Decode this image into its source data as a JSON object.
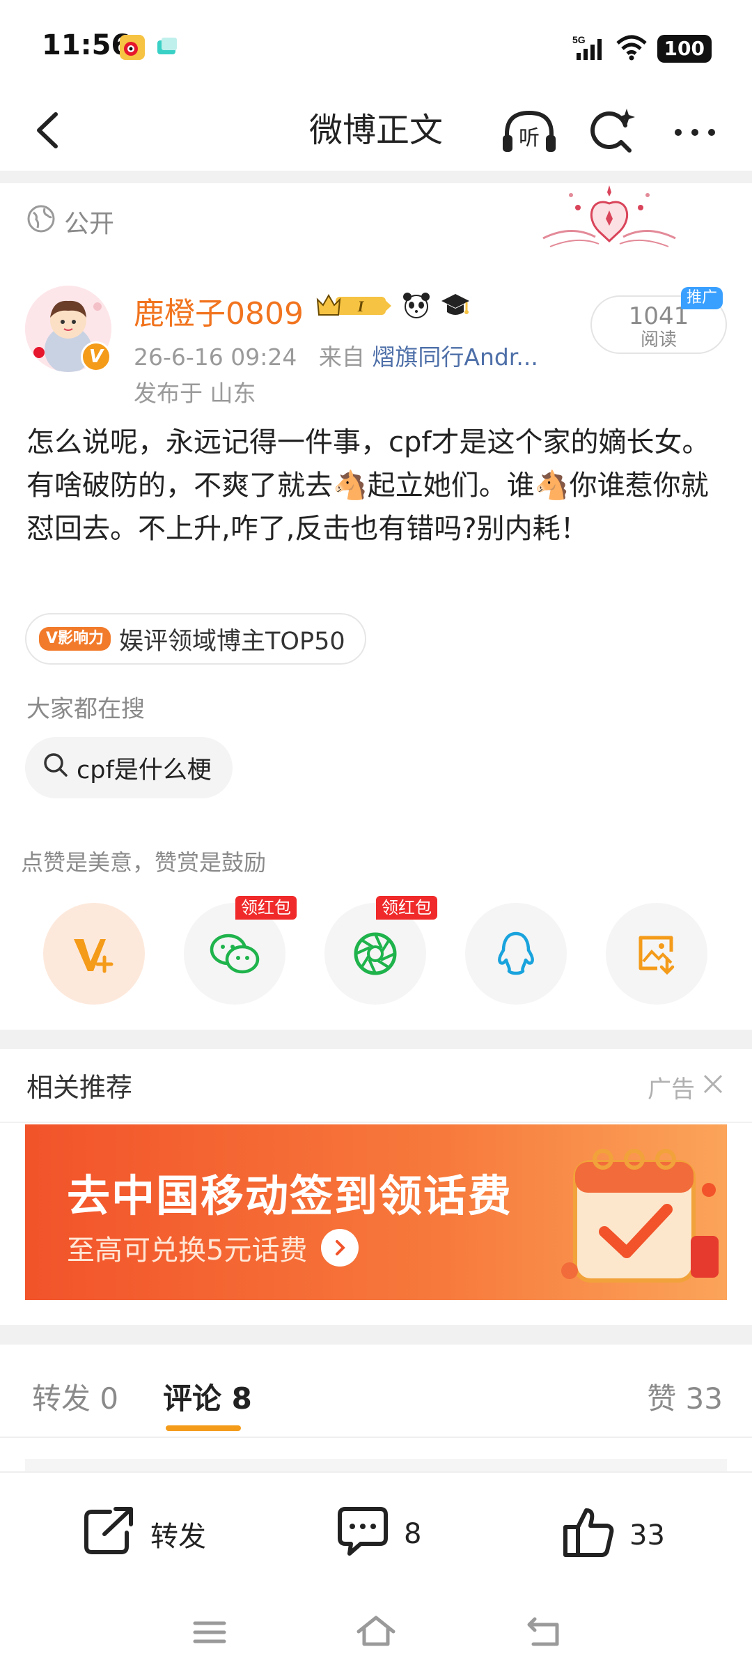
{
  "status_bar": {
    "time": "11:56",
    "network": "5G",
    "battery": "100"
  },
  "nav": {
    "title": "微博正文",
    "listen_label": "听"
  },
  "post": {
    "visibility": "公开",
    "username": "鹿橙子0809",
    "level_badge": "I",
    "timestamp": "26-6-16 09:24",
    "source_prefix": "来自",
    "source": "熠旗同行Andr...",
    "location": "发布于 山东",
    "read_count": "1041",
    "read_label": "阅读",
    "promo_tag": "推广",
    "text": "怎么说呢，永远记得一件事，cpf才是这个家的嫡长女。有啥破防的，不爽了就去🐴起立她们。谁🐴你谁惹你就怼回去。不上升,咋了,反击也有错吗?别内耗！",
    "influence_badge": "V影响力",
    "influence_text": "娱评领域博主TOP50",
    "search_heading": "大家都在搜",
    "search_chip": "cpf是什么梗",
    "reward_label": "点赞是美意，赞赏是鼓励",
    "share_items": [
      {
        "name": "reward",
        "badge": ""
      },
      {
        "name": "wechat",
        "badge": "领红包"
      },
      {
        "name": "moments",
        "badge": "领红包"
      },
      {
        "name": "qq",
        "badge": ""
      },
      {
        "name": "save-image",
        "badge": ""
      }
    ]
  },
  "related": {
    "title": "相关推荐",
    "ad_label": "广告",
    "banner_headline": "去中国移动签到领话费",
    "banner_sub": "至高可兑换5元话费"
  },
  "tabs": {
    "repost": "转发 0",
    "comment": "评论 8",
    "like": "赞 33"
  },
  "actions": {
    "repost": "转发",
    "comment_count": "8",
    "like_count": "33"
  },
  "colors": {
    "accent": "#f49b1a",
    "username": "#f1741f",
    "link": "#4e6fa8",
    "redpack": "#f02a2a"
  }
}
